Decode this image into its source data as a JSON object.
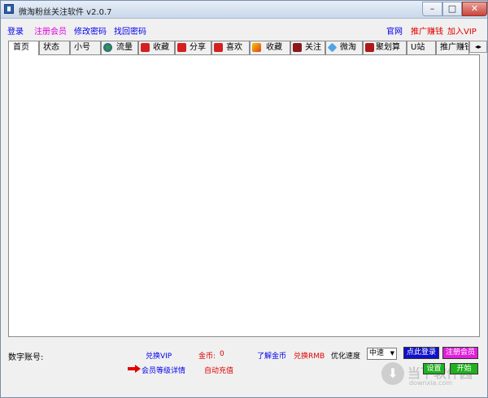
{
  "window": {
    "title": "微淘粉丝关注软件 v2.0.7",
    "controls": {
      "minimize": "–",
      "maximize": "□",
      "close": "✕"
    }
  },
  "topnav": {
    "login": "登录",
    "register": "注册会员",
    "change_password": "修改密码",
    "recover_password": "找回密码",
    "official_site": "官网",
    "promote_earn": "推广赚钱",
    "join_vip": "加入VIP"
  },
  "tabs": [
    {
      "label": "首页",
      "active": true
    },
    {
      "label": "状态"
    },
    {
      "label": "小号"
    },
    {
      "label": "流量",
      "icon": "globe-icon"
    },
    {
      "label": "收藏",
      "icon": "taobao-icon"
    },
    {
      "label": "分享",
      "icon": "taobao-icon"
    },
    {
      "label": "喜欢",
      "icon": "taobao-icon"
    },
    {
      "label": "收藏",
      "icon": "feather-icon"
    },
    {
      "label": "关注",
      "icon": "t-icon"
    },
    {
      "label": "微淘",
      "icon": "diamond-icon"
    },
    {
      "label": "聚划算",
      "icon": "juhuasuan-icon"
    },
    {
      "label": "U站"
    },
    {
      "label": "推广赚钱"
    }
  ],
  "tab_scroll": "◂▸",
  "footer": {
    "account_label": "数字账号:",
    "exchange_vip": "兑换VIP",
    "coins_label": "金币:",
    "coins_value": "0",
    "learn_coins": "了解金币",
    "exchange_rmb": "兑换RMB",
    "speed_label": "优化速度",
    "speed_value": "中速",
    "login_here": "点此登录",
    "register_member": "注册会员",
    "member_level": "会员等级详情",
    "auto_recharge": "自动充值",
    "settings": "设置",
    "start": "开始"
  },
  "watermark": {
    "brand": "当下软件园",
    "url": "downxia.com"
  }
}
